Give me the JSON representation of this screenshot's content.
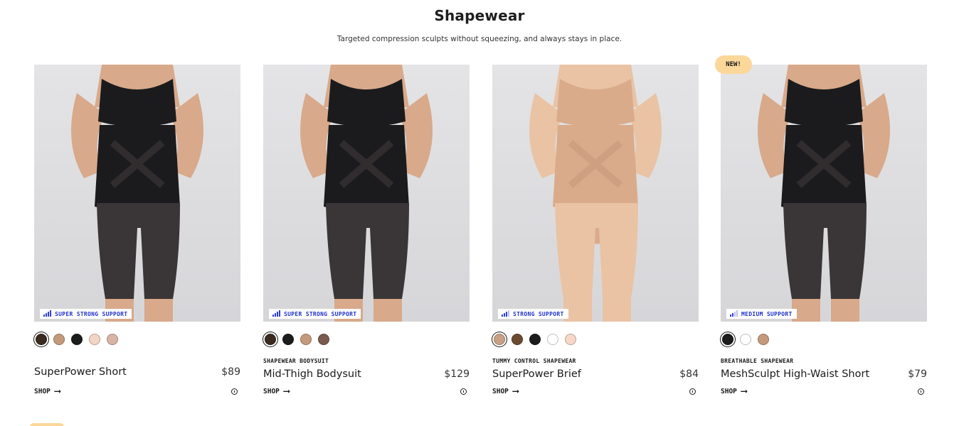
{
  "page": {
    "title": "Shapewear",
    "subtitle": "Targeted compression sculpts without squeezing, and always stays in place."
  },
  "colors": {
    "support_text": "#2234c8",
    "new_badge_bg": "#fbd79a"
  },
  "products": [
    {
      "name": "SuperPower Short",
      "price": "$89",
      "category": "",
      "support": {
        "label": "SUPER STRONG SUPPORT",
        "level": 4,
        "max": 4
      },
      "badge": "",
      "swatches": [
        "#3a2a1f",
        "#c49a7c",
        "#1c1c1c",
        "#f3d5c6",
        "#d9b4a6"
      ],
      "selected_swatch": 0,
      "shop_label": "SHOP",
      "color_tone": "black",
      "info_icon": "info-icon"
    },
    {
      "name": "Mid-Thigh Bodysuit",
      "price": "$129",
      "category": "SHAPEWEAR BODYSUIT",
      "support": {
        "label": "SUPER STRONG SUPPORT",
        "level": 4,
        "max": 4
      },
      "badge": "",
      "swatches": [
        "#3a2a1f",
        "#1c1c1c",
        "#c49a7c",
        "#7a5a4e"
      ],
      "selected_swatch": 0,
      "shop_label": "SHOP",
      "color_tone": "black",
      "info_icon": "info-icon"
    },
    {
      "name": "SuperPower Brief",
      "price": "$84",
      "category": "TUMMY CONTROL SHAPEWEAR",
      "support": {
        "label": "STRONG SUPPORT",
        "level": 3,
        "max": 4
      },
      "badge": "",
      "swatches": [
        "#c9a085",
        "#6b4a32",
        "#1c1c1c",
        "#ffffff",
        "#f7d8c8"
      ],
      "selected_swatch": 0,
      "shop_label": "SHOP",
      "color_tone": "nude",
      "info_icon": "info-icon"
    },
    {
      "name": "MeshSculpt High-Waist Short",
      "price": "$79",
      "category": "BREATHABLE SHAPEWEAR",
      "support": {
        "label": "MEDIUM SUPPORT",
        "level": 2,
        "max": 4
      },
      "badge": "NEW!",
      "swatches": [
        "#1c1c1c",
        "#ffffff",
        "#c49a7c"
      ],
      "selected_swatch": 0,
      "shop_label": "SHOP",
      "color_tone": "black",
      "info_icon": "info-icon"
    }
  ]
}
